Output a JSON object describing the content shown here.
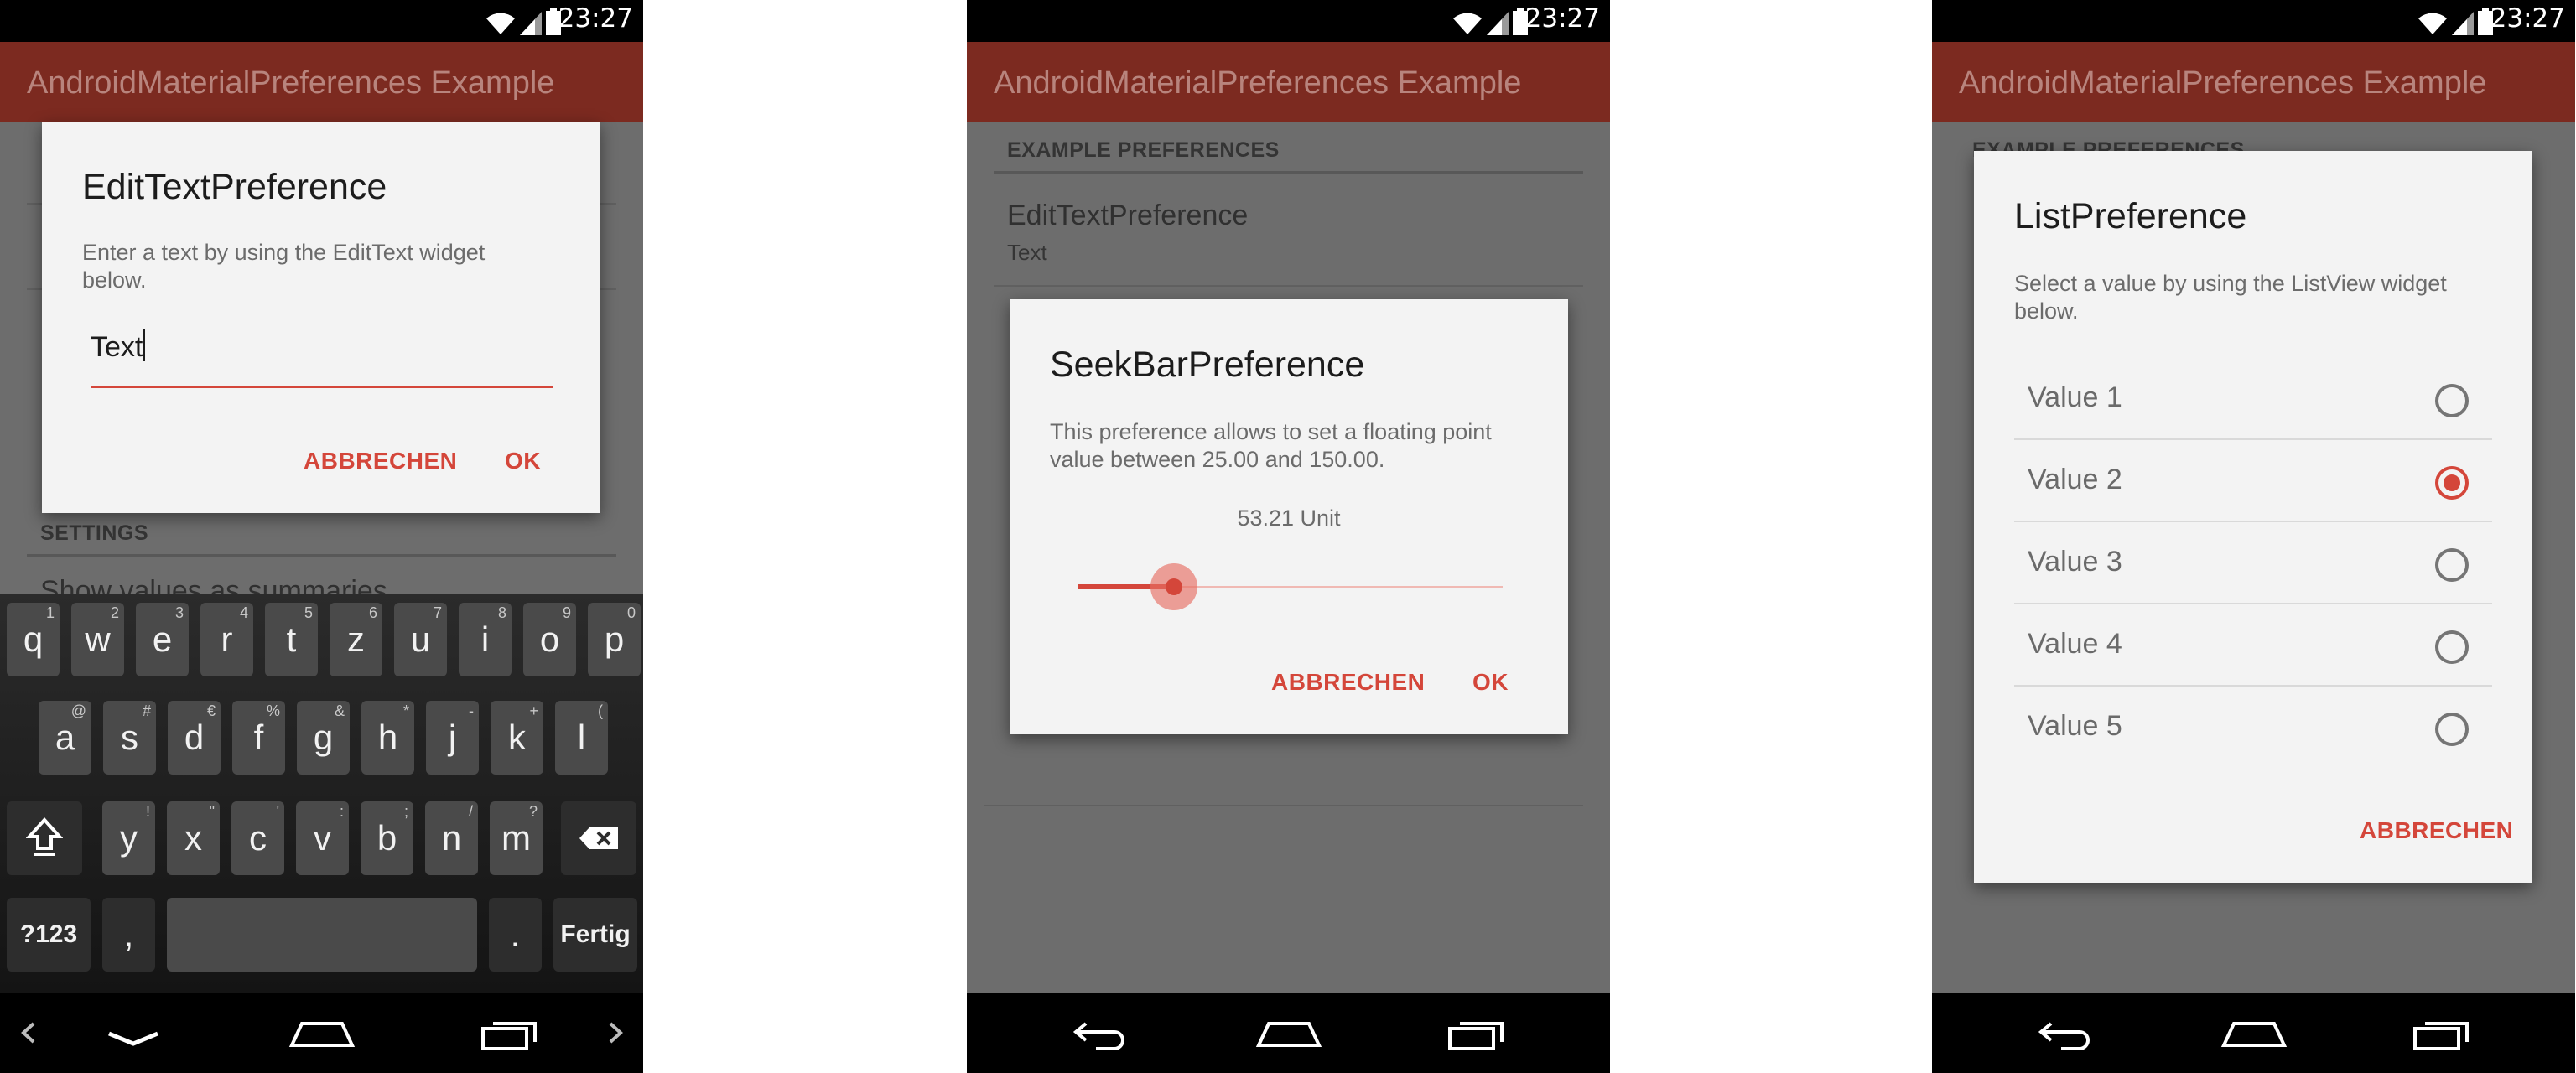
{
  "colors": {
    "accent": "#d4463a",
    "app_bar": "#7c2a20",
    "scrim": "#6d6d6d"
  },
  "status_bar": {
    "time": "23:27"
  },
  "app_bar": {
    "title": "AndroidMaterialPreferences Example"
  },
  "screen1": {
    "dialog": {
      "title": "EditTextPreference",
      "message": "Enter a text by using the EditText widget below.",
      "input_value": "Text",
      "cancel": "ABBRECHEN",
      "ok": "OK"
    },
    "background": {
      "settings_header": "SETTINGS",
      "item_partial": "Show values as summaries"
    },
    "keyboard": {
      "row1": [
        {
          "k": "q",
          "h": "1"
        },
        {
          "k": "w",
          "h": "2"
        },
        {
          "k": "e",
          "h": "3"
        },
        {
          "k": "r",
          "h": "4"
        },
        {
          "k": "t",
          "h": "5"
        },
        {
          "k": "z",
          "h": "6"
        },
        {
          "k": "u",
          "h": "7"
        },
        {
          "k": "i",
          "h": "8"
        },
        {
          "k": "o",
          "h": "9"
        },
        {
          "k": "p",
          "h": "0"
        }
      ],
      "row2": [
        {
          "k": "a",
          "h": "@"
        },
        {
          "k": "s",
          "h": "#"
        },
        {
          "k": "d",
          "h": "€"
        },
        {
          "k": "f",
          "h": "%"
        },
        {
          "k": "g",
          "h": "&"
        },
        {
          "k": "h",
          "h": "*"
        },
        {
          "k": "j",
          "h": "-"
        },
        {
          "k": "k",
          "h": "+"
        },
        {
          "k": "l",
          "h": "("
        }
      ],
      "row3": [
        {
          "k": "y",
          "h": "!"
        },
        {
          "k": "x",
          "h": "\""
        },
        {
          "k": "c",
          "h": "'"
        },
        {
          "k": "v",
          "h": ":"
        },
        {
          "k": "b",
          "h": ";"
        },
        {
          "k": "n",
          "h": "/"
        },
        {
          "k": "m",
          "h": "?"
        }
      ],
      "symbols": "?123",
      "comma": ",",
      "period": ".",
      "done": "Fertig"
    }
  },
  "screen2": {
    "background": {
      "header": "EXAMPLE PREFERENCES",
      "item_title": "EditTextPreference",
      "item_summary": "Text"
    },
    "dialog": {
      "title": "SeekBarPreference",
      "message": "This preference allows to set a floating point value between 25.00 and 150.00.",
      "value_label": "53.21 Unit",
      "value": 53.21,
      "min": 25.0,
      "max": 150.0,
      "cancel": "ABBRECHEN",
      "ok": "OK"
    }
  },
  "screen3": {
    "background": {
      "header_partial": "EXAMPLE PREFERENCES"
    },
    "dialog": {
      "title": "ListPreference",
      "message": "Select a value by using the ListView widget below.",
      "options": [
        "Value 1",
        "Value 2",
        "Value 3",
        "Value 4",
        "Value 5"
      ],
      "selected_index": 1,
      "cancel": "ABBRECHEN"
    }
  }
}
